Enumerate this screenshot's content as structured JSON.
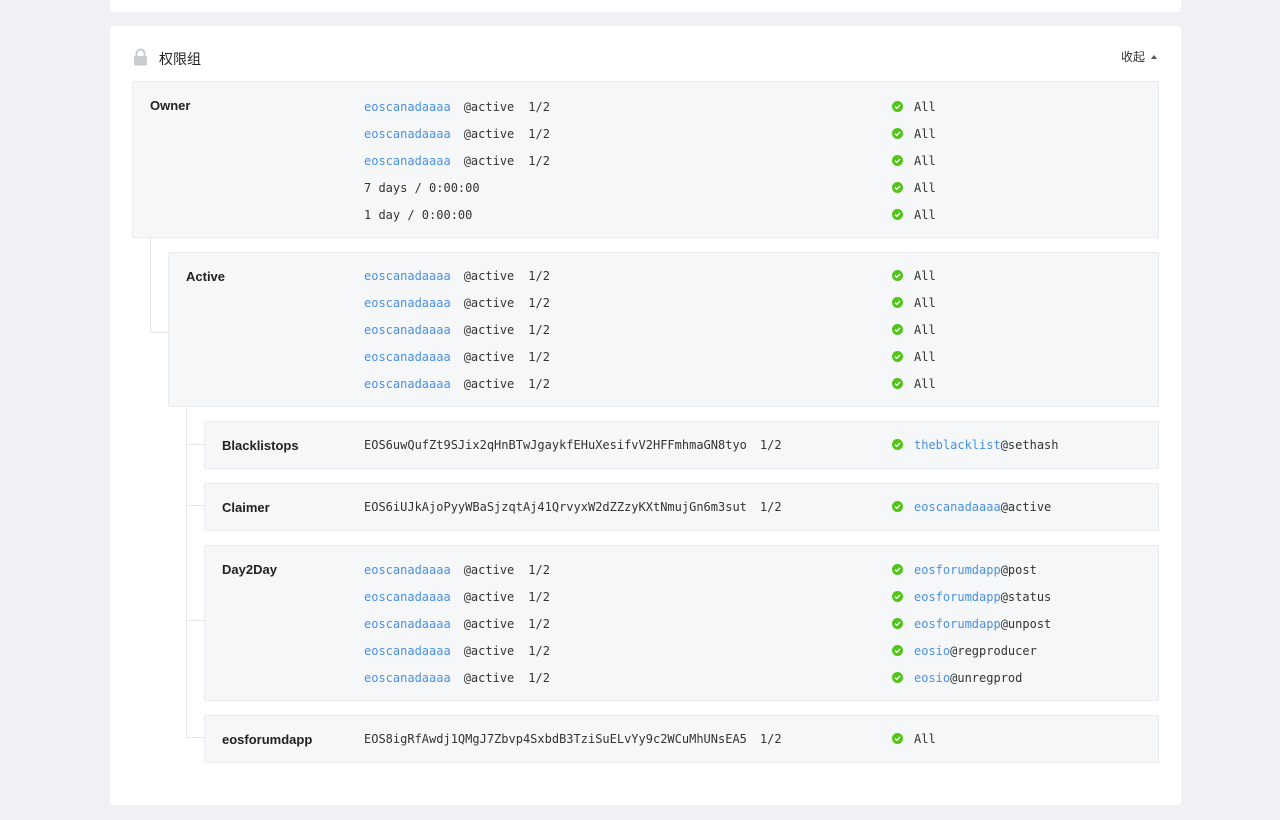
{
  "panel": {
    "title": "权限组",
    "collapse_label": "收起"
  },
  "groups": {
    "owner": {
      "name": "Owner",
      "rows": [
        {
          "account": "eoscanadaaaa",
          "perm": "@active",
          "weight": "1/2",
          "scope": "All"
        },
        {
          "account": "eoscanadaaaa",
          "perm": "@active",
          "weight": "1/2",
          "scope": "All"
        },
        {
          "account": "eoscanadaaaa",
          "perm": "@active",
          "weight": "1/2",
          "scope": "All"
        },
        {
          "text": "7 days / 0:00:00",
          "scope": "All"
        },
        {
          "text": "1 day / 0:00:00",
          "scope": "All"
        }
      ]
    },
    "active": {
      "name": "Active",
      "rows": [
        {
          "account": "eoscanadaaaa",
          "perm": "@active",
          "weight": "1/2",
          "scope": "All"
        },
        {
          "account": "eoscanadaaaa",
          "perm": "@active",
          "weight": "1/2",
          "scope": "All"
        },
        {
          "account": "eoscanadaaaa",
          "perm": "@active",
          "weight": "1/2",
          "scope": "All"
        },
        {
          "account": "eoscanadaaaa",
          "perm": "@active",
          "weight": "1/2",
          "scope": "All"
        },
        {
          "account": "eoscanadaaaa",
          "perm": "@active",
          "weight": "1/2",
          "scope": "All"
        }
      ]
    },
    "blacklistops": {
      "name": "Blacklistops",
      "key": "EOS6uwQufZt9SJix2qHnBTwJgaykfEHuXesifvV2HFFmhmaGN8tyo",
      "weight": "1/2",
      "link_account": "theblacklist",
      "link_action": "@sethash"
    },
    "claimer": {
      "name": "Claimer",
      "key": "EOS6iUJkAjoPyyWBaSjzqtAj41QrvyxW2dZZzyKXtNmujGn6m3sut",
      "weight": "1/2",
      "link_account": "eoscanadaaaa",
      "link_action": "@active"
    },
    "day2day": {
      "name": "Day2Day",
      "rows": [
        {
          "account": "eoscanadaaaa",
          "perm": "@active",
          "weight": "1/2",
          "link_account": "eosforumdapp",
          "link_action": "@post"
        },
        {
          "account": "eoscanadaaaa",
          "perm": "@active",
          "weight": "1/2",
          "link_account": "eosforumdapp",
          "link_action": "@status"
        },
        {
          "account": "eoscanadaaaa",
          "perm": "@active",
          "weight": "1/2",
          "link_account": "eosforumdapp",
          "link_action": "@unpost"
        },
        {
          "account": "eoscanadaaaa",
          "perm": "@active",
          "weight": "1/2",
          "link_account": "eosio",
          "link_action": "@regproducer"
        },
        {
          "account": "eoscanadaaaa",
          "perm": "@active",
          "weight": "1/2",
          "link_account": "eosio",
          "link_action": "@unregprod"
        }
      ]
    },
    "eosforumdapp": {
      "name": "eosforumdapp",
      "key": "EOS8igRfAwdj1QMgJ7Zbvp4SxbdB3TziSuELvYy9c2WCuMhUNsEA5",
      "weight": "1/2",
      "scope": "All"
    }
  },
  "colors": {
    "link": "#4a90e2",
    "check": "#52c41a",
    "box_bg": "#f6f7f8"
  }
}
